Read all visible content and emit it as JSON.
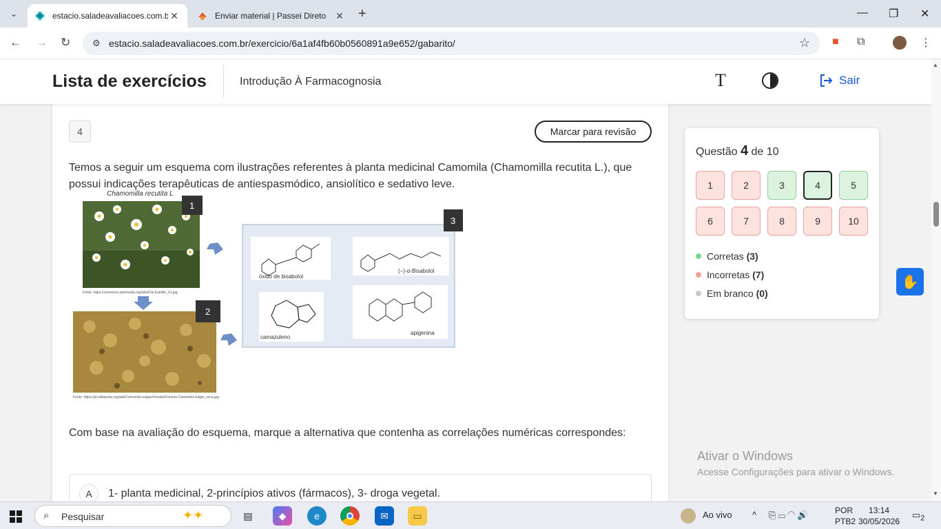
{
  "browser": {
    "tabs": [
      {
        "title": "estacio.saladeavaliacoes.com.br",
        "active": true
      },
      {
        "title": "Enviar material | Passei Direto",
        "active": false
      }
    ],
    "url": "estacio.saladeavaliacoes.com.br/exercicio/6a1af4fb60b0560891a9e652/gabarito/"
  },
  "header": {
    "title": "Lista de exercícios",
    "course": "Introdução À Farmacognosia",
    "logout_label": "Sair"
  },
  "question": {
    "number": "4",
    "review_button": "Marcar para revisão",
    "stem": "Temos a seguir um esquema com ilustrações referentes à planta medicinal Camomila (Chamomilla recutita L.), que possui indicações terapêuticas de antiespasmódico, ansiolítico e sedativo leve.",
    "prompt": "Com base na avaliação do esquema, marque a alternativa que contenha as correlações numéricas correspondes:",
    "figure": {
      "plant_caption": "Chamomilla recutita L",
      "source1": "Fonte: https://commons.wikimedia.org/wiki/File:Kamille_01.jpg",
      "source2": "Fonte: https://pt.wikipedia.org/wiki/Camomila-vulgar#/media/Ficheiro:Camomila-vulgar_seca.jpg",
      "label1": "1",
      "label2": "2",
      "label3": "3",
      "compounds": [
        "óxido de bisabolol",
        "(−)-α-Bisabolol",
        "camazuleno",
        "apigenina"
      ]
    },
    "options": [
      {
        "letter": "A",
        "text": "1- planta medicinal, 2-princípios ativos (fármacos), 3- droga vegetal."
      }
    ]
  },
  "navigator": {
    "label_prefix": "Questão",
    "current": "4",
    "label_suffix": "de 10",
    "questions": [
      {
        "n": "1",
        "status": "wrong"
      },
      {
        "n": "2",
        "status": "wrong"
      },
      {
        "n": "3",
        "status": "right"
      },
      {
        "n": "4",
        "status": "right"
      },
      {
        "n": "5",
        "status": "right"
      },
      {
        "n": "6",
        "status": "wrong"
      },
      {
        "n": "7",
        "status": "wrong"
      },
      {
        "n": "8",
        "status": "wrong"
      },
      {
        "n": "9",
        "status": "wrong"
      },
      {
        "n": "10",
        "status": "wrong"
      }
    ],
    "legend": [
      {
        "label": "Corretas",
        "count": "(3)",
        "color": "#7bd88f"
      },
      {
        "label": "Incorretas",
        "count": "(7)",
        "color": "#f4a093"
      },
      {
        "label": "Em branco",
        "count": "(0)",
        "color": "#c8c8c8"
      }
    ]
  },
  "watermark": {
    "title": "Ativar o Windows",
    "subtitle": "Acesse Configurações para ativar o Windows."
  },
  "taskbar": {
    "search_placeholder": "Pesquisar",
    "live_label": "Ao vivo",
    "lang": "POR",
    "layout": "PTB2",
    "time": "13:14",
    "date": "30/05/2026",
    "notifications": "2"
  },
  "colors": {
    "accent": "#1a56db",
    "correct": "#dcf3e0",
    "incorrect": "#fde3df"
  }
}
